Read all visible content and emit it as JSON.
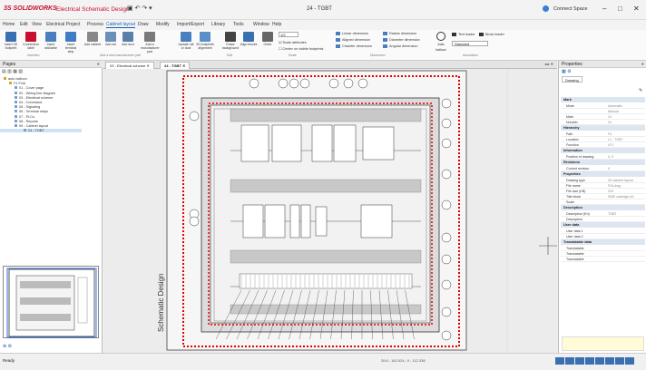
{
  "titlebar": {
    "logo": "3S SOLIDWORKS",
    "app_title": "Electrical Schematic Design",
    "doc_title": "24 - TGBT",
    "account": "Connect Space"
  },
  "menu": [
    "Home",
    "Edit",
    "View",
    "Electrical Project",
    "Process",
    "Cabinet layout",
    "Draw",
    "Modify",
    "Import/Export",
    "Library",
    "Tools",
    "Window",
    "Help"
  ],
  "menu_active_index": 5,
  "ribbon": {
    "buttons": [
      {
        "label": "Insert 2D footprint",
        "color": "#3a6fb0"
      },
      {
        "label": "Connection label",
        "color": "#c8102e"
      },
      {
        "label": "Insert rail/cable",
        "color": "#4a7fbf"
      },
      {
        "label": "Insert terminal strip",
        "color": "#3f7cc4"
      },
      {
        "label": "Add cabinet",
        "color": "#888888"
      },
      {
        "label": "Add rail",
        "color": "#6a8fb8"
      },
      {
        "label": "Add duct",
        "color": "#5a7fa8"
      },
      {
        "label": "Add a manufacturer part",
        "color": "#7a7a7a"
      },
      {
        "label": "Update rail or duct",
        "color": "#4a7fbf"
      },
      {
        "label": "2D footprints alignment",
        "color": "#5a8fca"
      },
      {
        "label": "Erase background",
        "color": "#444444"
      },
      {
        "label": "Align blocks",
        "color": "#3a6fb0"
      },
      {
        "label": "Order",
        "color": "#666666"
      }
    ],
    "groups": [
      "Insertion",
      "Add a new manufacturer part",
      "Edit",
      "Scale",
      "Dimension",
      "Annotation"
    ],
    "scale": {
      "value": "1/2",
      "opt1": "Scale attributes",
      "opt2": "Center on visible footprints"
    },
    "dimension": [
      "Linear dimension",
      "Aligned dimension",
      "Chamfer dimension",
      "Radius dimension",
      "Diameter dimension",
      "Angular dimension"
    ],
    "annotation": {
      "balloon": "Auto balloon",
      "leader": "Text leader",
      "block_leader": "Block leader",
      "style": "Standard"
    }
  },
  "pages": {
    "title": "Pages",
    "tree": [
      {
        "label": "auto balloon",
        "indent": 4,
        "sel": false
      },
      {
        "label": "F1 Fold",
        "indent": 10,
        "sel": false
      },
      {
        "label": "01 - Cover page",
        "indent": 16,
        "sel": false
      },
      {
        "label": "02 - Wiring line diagram",
        "indent": 16,
        "sel": false
      },
      {
        "label": "03 - Electrical scheme",
        "indent": 16,
        "sel": false
      },
      {
        "label": "04 - Command",
        "indent": 16,
        "sel": false
      },
      {
        "label": "05 - Signaling",
        "indent": 16,
        "sel": false
      },
      {
        "label": "06 - Terminal strips",
        "indent": 16,
        "sel": false
      },
      {
        "label": "07 - PLCs",
        "indent": 16,
        "sel": false
      },
      {
        "label": "08 - Reports",
        "indent": 16,
        "sel": false
      },
      {
        "label": "09 - Cabinet layout",
        "indent": 16,
        "sel": false
      },
      {
        "label": "24 - TGBT",
        "indent": 26,
        "sel": true
      }
    ]
  },
  "tabs": [
    "03 - Electrical scheme",
    "24 - TGBT"
  ],
  "canvas": {
    "sheet_label": "Schematic Design"
  },
  "properties": {
    "title": "Properties",
    "tab": "Drawing",
    "sections": [
      {
        "name": "Mark",
        "rows": [
          [
            "Mode",
            "Automatic"
          ],
          [
            "",
            "Manual"
          ],
          [
            "Mark",
            "24"
          ],
          [
            "Number",
            "24"
          ]
        ]
      },
      {
        "name": "Hierarchy",
        "rows": [
          [
            "Path",
            "F4"
          ],
          [
            "Location",
            "L1 - TGBT"
          ],
          [
            "Function",
            "LF1"
          ]
        ]
      },
      {
        "name": "Information",
        "rows": [
          [
            "Position of drawing",
            "0, 0"
          ]
        ]
      },
      {
        "name": "Revisions",
        "rows": [
          [
            "Current revision",
            "0"
          ]
        ]
      },
      {
        "name": "Properties",
        "rows": [
          [
            "Drawing type",
            "2D cabinet layout"
          ],
          [
            "File name",
            "F24.dwg"
          ],
          [
            "File size (KB)",
            "319"
          ],
          [
            "Title block",
            "SWE cartridge A3"
          ],
          [
            "Scale",
            ""
          ]
        ]
      },
      {
        "name": "Description",
        "rows": [
          [
            "Description (En)",
            "TGBT"
          ],
          [
            "Description",
            ""
          ]
        ]
      },
      {
        "name": "User data",
        "rows": [
          [
            "User data 1",
            ""
          ],
          [
            "User data 2",
            ""
          ]
        ]
      },
      {
        "name": "Translatable data",
        "rows": [
          [
            "Translatable",
            ""
          ],
          [
            "Translatable",
            ""
          ],
          [
            "Translatable",
            ""
          ]
        ]
      }
    ]
  },
  "status": {
    "left": "Ready",
    "coords": "26.6 ; 162.024 ; 0 ; 112.338"
  }
}
